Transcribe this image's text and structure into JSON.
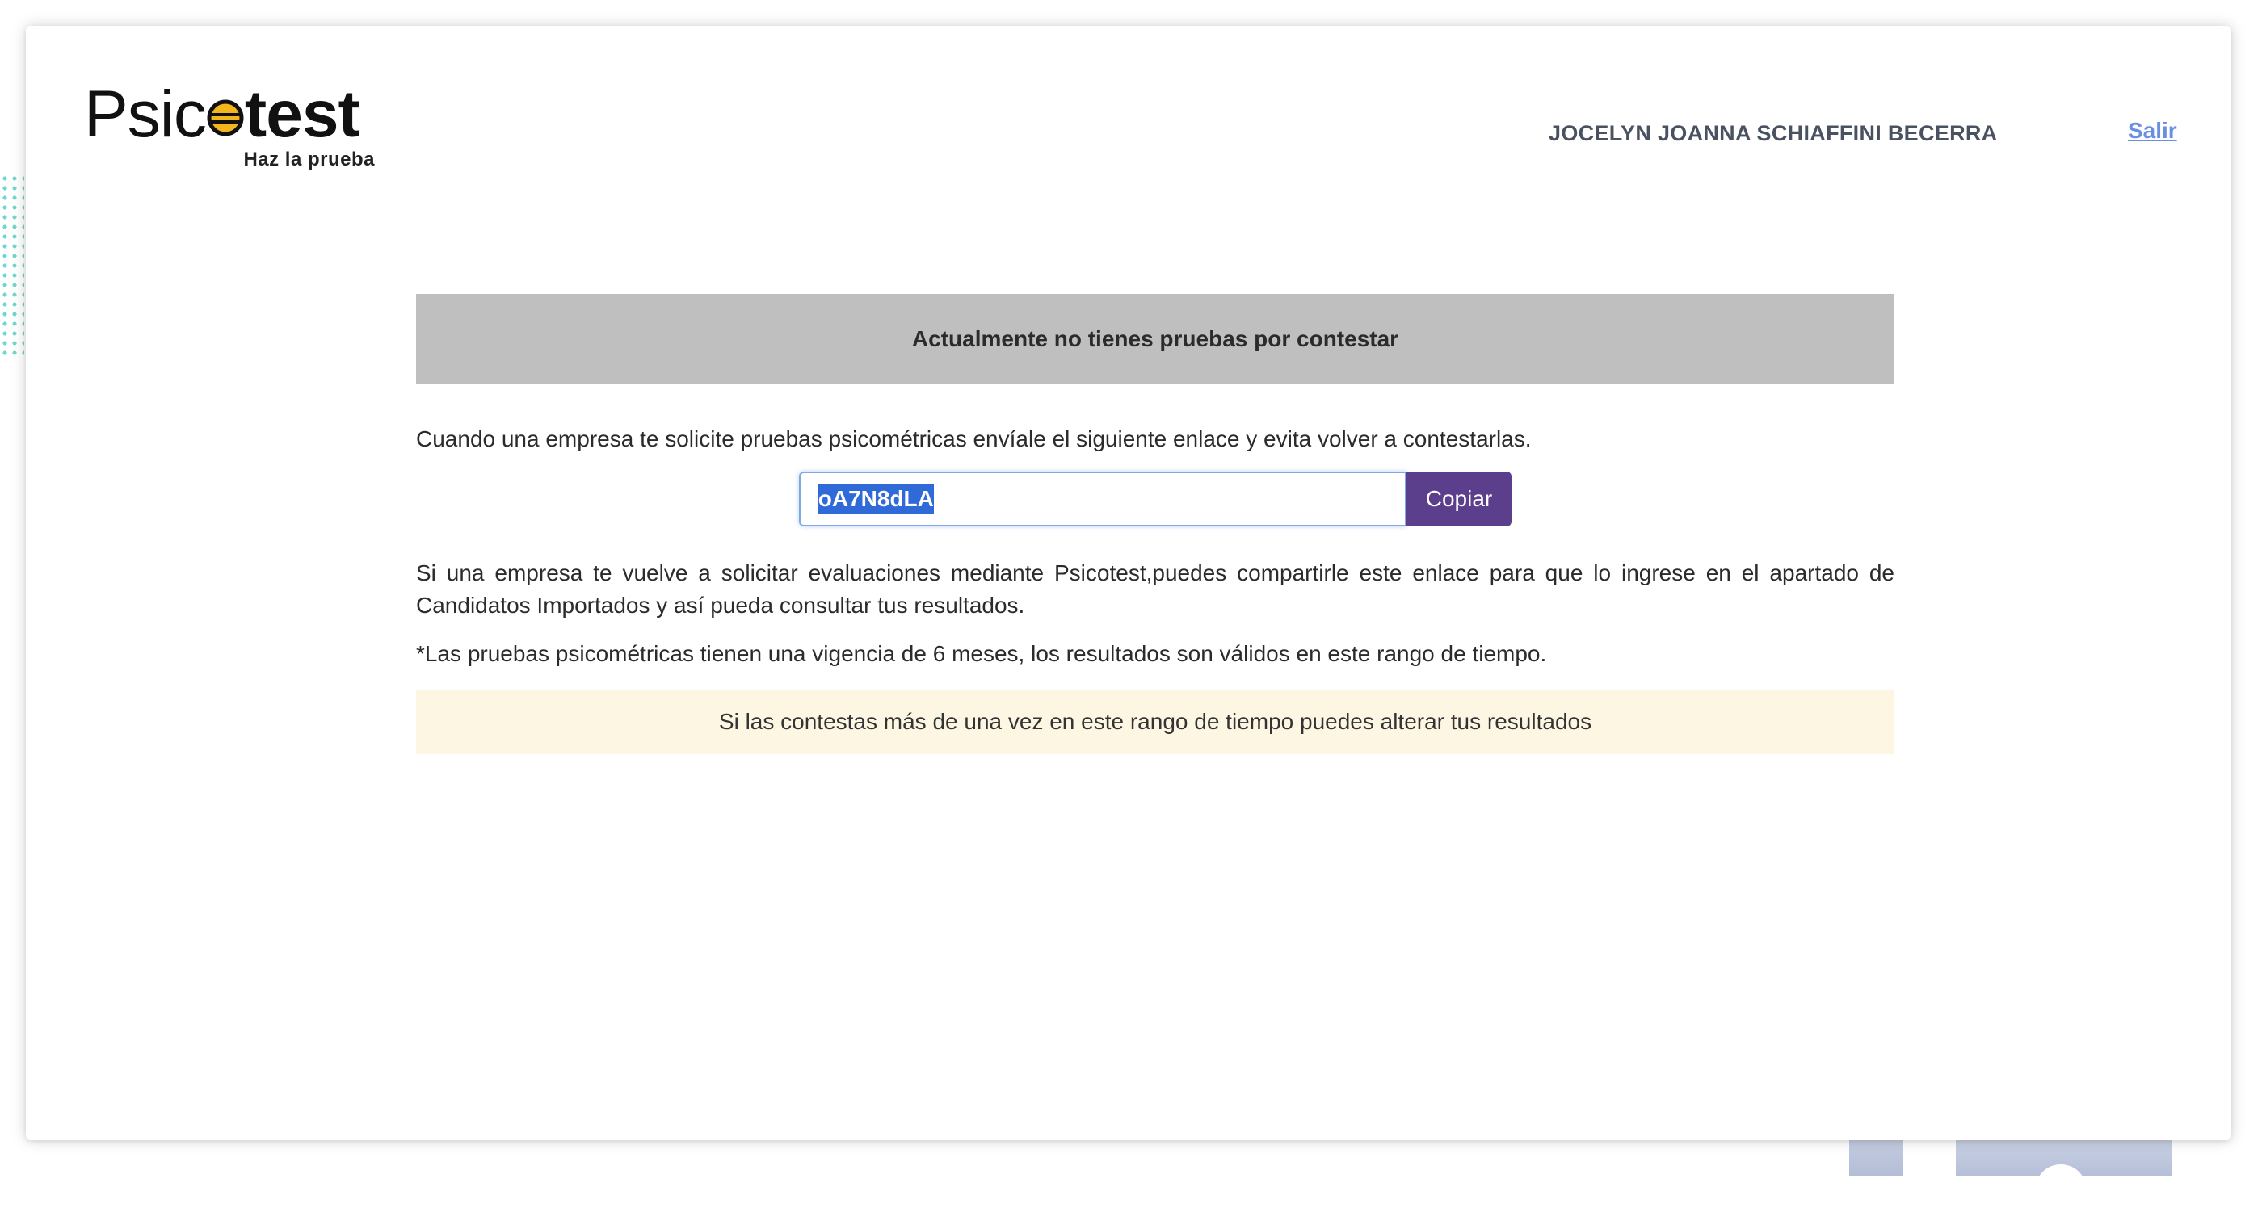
{
  "header": {
    "logo": {
      "word_light": "Psic",
      "word_bold": "test",
      "tagline": "Haz la prueba"
    },
    "user_name": "JOCELYN JOANNA SCHIAFFINI BECERRA",
    "logout_label": "Salir"
  },
  "main": {
    "banner_text": "Actualmente no tienes pruebas por contestar",
    "intro_text": "Cuando una empresa te solicite pruebas psicométricas envíale el siguiente enlace y evita volver a contestarlas.",
    "share_code": "oA7N8dLA",
    "copy_button_label": "Copiar",
    "info_text": "Si una empresa te vuelve a solicitar evaluaciones mediante Psicotest,puedes compartirle este enlace para que lo ingrese en el apartado de Candidatos Importados y así pueda consultar tus resultados.",
    "validity_note": "*Las pruebas psicométricas tienen una vigencia de 6 meses, los resultados son válidos en este rango de tiempo.",
    "warning_text": "Si las contestas más de una vez en este rango de tiempo puedes alterar tus resultados"
  },
  "colors": {
    "accent_button": "#5c3f8c",
    "banner_bg": "#bfbfbf",
    "warning_bg": "#fdf6e3",
    "link": "#6a8fe0",
    "logo_bee_yellow": "#f2b51c"
  },
  "icons": [
    "bee-o-logo-icon"
  ]
}
